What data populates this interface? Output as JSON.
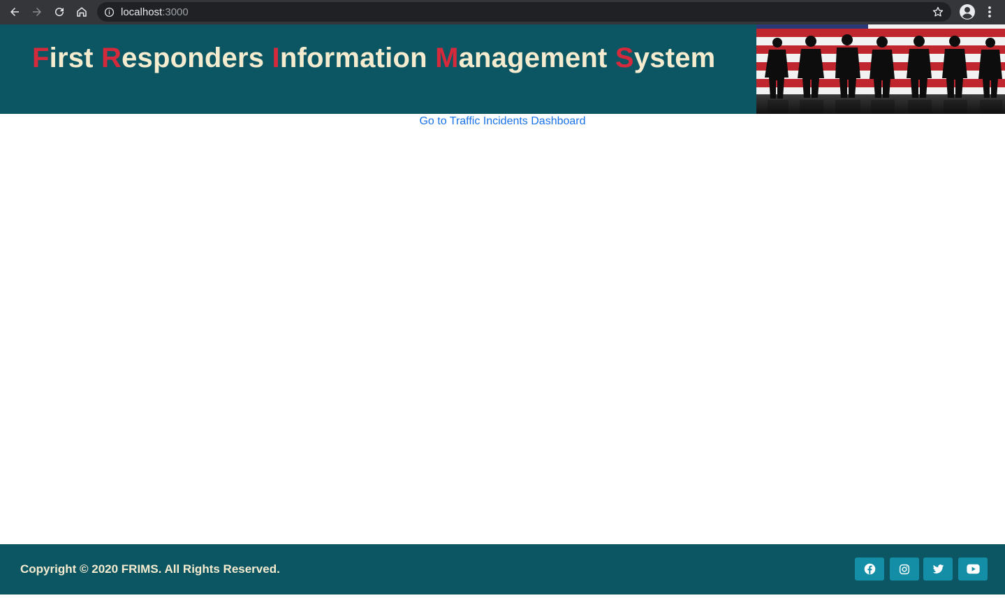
{
  "browser": {
    "url_host": "localhost",
    "url_port": ":3000"
  },
  "header": {
    "title_words": [
      {
        "cap": "F",
        "rest": "irst"
      },
      {
        "cap": "R",
        "rest": "esponders"
      },
      {
        "cap": "I",
        "rest": "nformation"
      },
      {
        "cap": "M",
        "rest": "anagement"
      },
      {
        "cap": "S",
        "rest": "ystem"
      }
    ]
  },
  "main": {
    "dashboard_link": "Go to Traffic Incidents Dashboard"
  },
  "footer": {
    "copyright": "Copyright © 2020 FRIMS. All Rights Reserved.",
    "social_icons": [
      "facebook-icon",
      "instagram-icon",
      "twitter-icon",
      "youtube-icon"
    ]
  },
  "colors": {
    "brand_teal": "#0c5563",
    "accent_red": "#d42a3c",
    "title_cream": "#f5ecd0",
    "social_button": "#148ea6",
    "link_blue": "#1a73e8"
  }
}
